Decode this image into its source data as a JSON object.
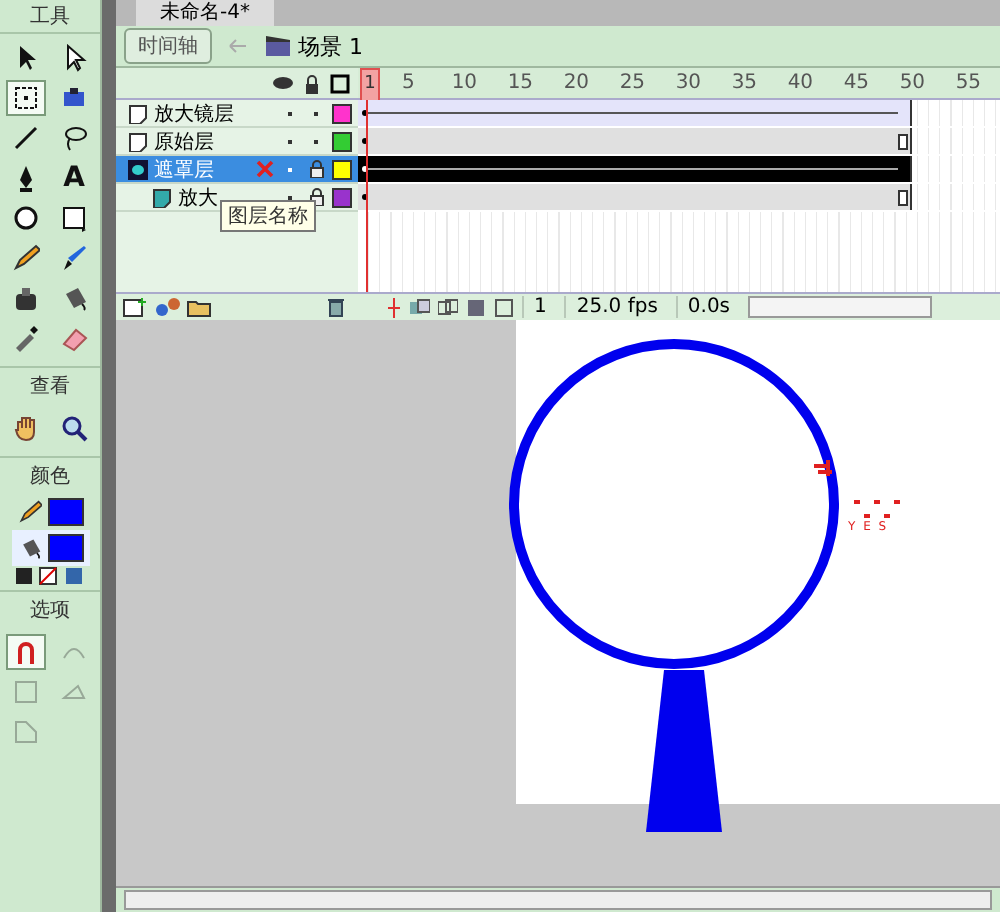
{
  "toolbox": {
    "title": "工具",
    "tools": [
      {
        "kind": "arrow",
        "selected": false
      },
      {
        "kind": "subselect",
        "selected": false
      },
      {
        "kind": "transform",
        "selected": true
      },
      {
        "kind": "gradient",
        "selected": false
      },
      {
        "kind": "line",
        "selected": false
      },
      {
        "kind": "lasso",
        "selected": false
      },
      {
        "kind": "pen",
        "selected": false
      },
      {
        "kind": "text",
        "label": "A",
        "selected": false
      },
      {
        "kind": "oval",
        "selected": false
      },
      {
        "kind": "rect",
        "selected": false
      },
      {
        "kind": "pencil",
        "selected": false
      },
      {
        "kind": "brush",
        "selected": false
      },
      {
        "kind": "inkbottle",
        "selected": false
      },
      {
        "kind": "bucket",
        "selected": false
      },
      {
        "kind": "dropper",
        "selected": false
      },
      {
        "kind": "eraser",
        "selected": false
      }
    ],
    "view_title": "查看",
    "view_tools": [
      {
        "kind": "hand",
        "selected": false
      },
      {
        "kind": "zoom",
        "selected": false
      }
    ],
    "colors_title": "颜色",
    "colors": [
      {
        "kind": "stroke",
        "color": "#0000ff",
        "selected": false
      },
      {
        "kind": "fill",
        "color": "#0000ff",
        "selected": true
      }
    ],
    "options_title": "选项",
    "options": [
      {
        "kind": "magnet",
        "on": true,
        "disabled": false
      },
      {
        "kind": "smooth",
        "on": false,
        "disabled": true
      },
      {
        "kind": "straighten",
        "on": false,
        "disabled": true
      },
      {
        "kind": "rotate",
        "on": false,
        "disabled": true
      },
      {
        "kind": "scale",
        "on": false,
        "disabled": true
      }
    ]
  },
  "document_tab": "未命名-4*",
  "scene_bar": {
    "timeline_button": "时间轴",
    "scene": "场景 1"
  },
  "timeline": {
    "ruler": [
      "1",
      "5",
      "10",
      "15",
      "20",
      "25",
      "30",
      "35",
      "40",
      "45",
      "50",
      "55"
    ],
    "layers": [
      {
        "name": "放大镜层",
        "kind": "normal",
        "selected": false,
        "color": "#ff33cc",
        "locked": false,
        "edit_blocked": false,
        "tween": true
      },
      {
        "name": "原始层",
        "kind": "normal",
        "selected": false,
        "color": "#33cc33",
        "locked": false,
        "edit_blocked": false,
        "tween": false
      },
      {
        "name": "遮罩层",
        "kind": "mask",
        "selected": true,
        "color": "#ffff00",
        "locked": true,
        "edit_blocked": true,
        "tween": true
      },
      {
        "name": "放大",
        "kind": "masked",
        "selected": false,
        "color": "#9933cc",
        "locked": true,
        "edit_blocked": false,
        "tween": false
      }
    ],
    "tooltip": "图层名称",
    "current_frame": "1",
    "frame_rate": "25.0 fps",
    "elapsed": "0.0s"
  },
  "stage": {
    "note_text": "Y E S"
  }
}
